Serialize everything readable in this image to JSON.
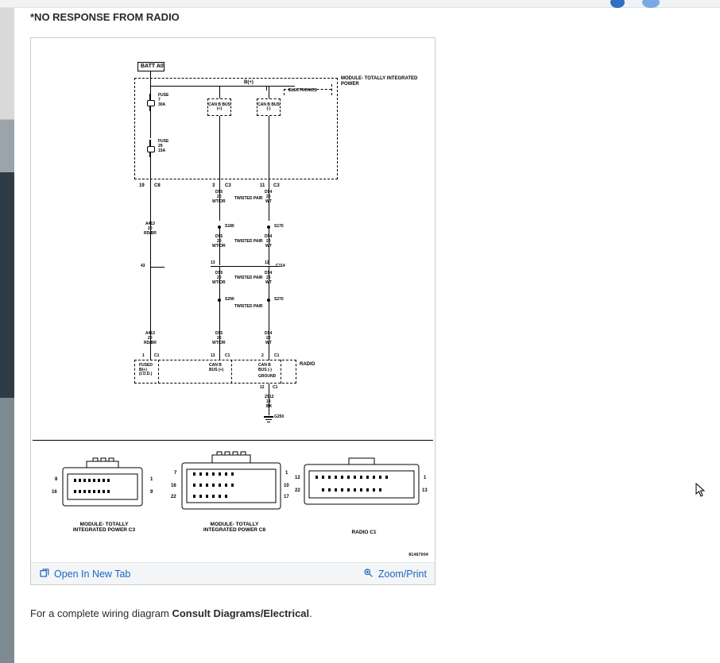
{
  "title": "*NO RESPONSE FROM RADIO",
  "figure": {
    "toolbar": {
      "open_new_tab": "Open In New Tab",
      "zoom_print": "Zoom/Print"
    },
    "diagram": {
      "batt_label": "BATT A0",
      "module_label": "MODULE-\nTOTALLY\nINTEGRATED\nPOWER",
      "electronics_label": "ELECTRONICS",
      "bplus": "B(+)",
      "fuse1": {
        "label": "FUSE",
        "num": "7",
        "amps": "30A"
      },
      "fuse2": {
        "label": "FUSE",
        "num": "29",
        "amps": "15A"
      },
      "can_b_plus": "CAN B\nBUS (+)",
      "can_b_minus": "CAN B\nBUS (-)",
      "c8_cav": "19",
      "c8_name": "C8",
      "c3a_cav": "3",
      "c3a_name": "C3",
      "c3b_cav": "11",
      "c3b_name": "C3",
      "pair_label": "TWISTED\nPAIR",
      "wires": {
        "d55": "D55",
        "d54": "D54",
        "w20": "20",
        "wtor": "WT/OR",
        "wt": "WT",
        "a413": "A413",
        "rdbr": "RD/BR"
      },
      "splices": {
        "s180": "S180",
        "s170": "S170",
        "s290": "S290",
        "s270": "S270"
      },
      "c114": "C114",
      "c114_l": "13",
      "c114_r": "12",
      "a_node": "43",
      "c1_radio_l": "13",
      "c1_radio_r": "2",
      "c1_fused": "1",
      "c1_name": "C1",
      "radio_label": "RADIO",
      "fused_label": "FUSED\nB(+)\n(I.O.D.)",
      "ground_label": "GROUND",
      "ground_c1_cav": "12",
      "ground_c1_name": "C1",
      "z912": "Z912",
      "z18": "18",
      "bk": "BK",
      "g250": "G250",
      "connectors": {
        "c3": {
          "name": "MODULE-\nTOTALLY\nINTEGRATED\nPOWER C3",
          "left": "8",
          "right1": "1",
          "left2": "16",
          "right2": "9"
        },
        "c8": {
          "name": "MODULE-\nTOTALLY\nINTEGRATED\nPOWER C8",
          "l1": "7",
          "r1": "1",
          "l2": "16",
          "r2": "10",
          "l3": "22",
          "r3": "17"
        },
        "radio": {
          "name": "RADIO C1",
          "l1": "12",
          "r1": "1",
          "l2": "22",
          "r2": "13"
        }
      },
      "part_number": "81467004"
    }
  },
  "caption_prefix": "For a complete wiring diagram ",
  "caption_bold": "Consult Diagrams/Electrical",
  "caption_suffix": "."
}
